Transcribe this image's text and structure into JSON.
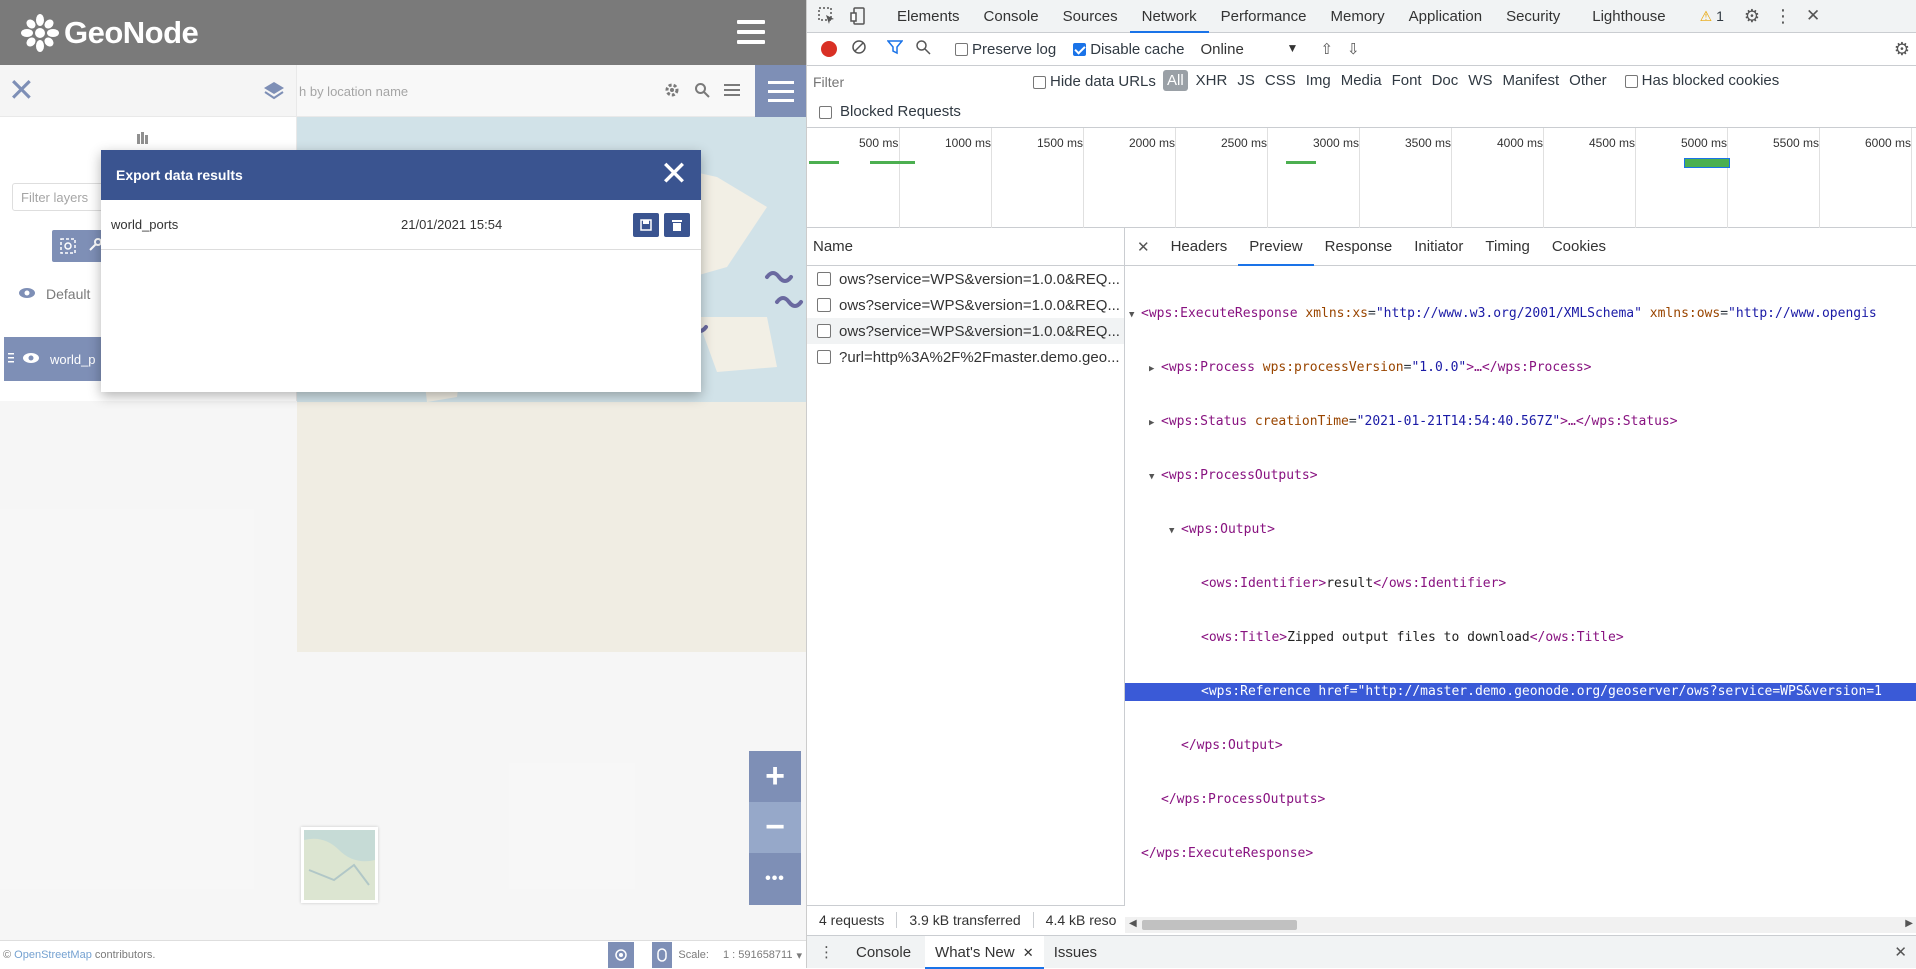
{
  "geonode": {
    "logo_text": "GeoNode",
    "search_placeholder": "h by location name",
    "filter_placeholder": "Filter layers",
    "group_name": "Default",
    "layer_name": "world_p",
    "attribution_prefix": "©",
    "attribution_link": "OpenStreetMap",
    "attribution_suffix": "contributors.",
    "scale_label": "Scale:",
    "scale_value": "1 : 591658711",
    "zoom_in": "+",
    "zoom_out": "−",
    "more": "•••"
  },
  "dialog": {
    "title": "Export data results",
    "row": {
      "name": "world_ports",
      "date": "21/01/2021 15:54"
    }
  },
  "devtools": {
    "tabs": [
      "Elements",
      "Console",
      "Sources",
      "Network",
      "Performance",
      "Memory",
      "Application",
      "Security",
      "Lighthouse"
    ],
    "active_tab": "Network",
    "warning_count": "1",
    "toolbar": {
      "preserve_log": "Preserve log",
      "disable_cache": "Disable cache",
      "throttle": "Online"
    },
    "filter": {
      "placeholder": "Filter",
      "hide_data_urls": "Hide data URLs",
      "types": [
        "All",
        "XHR",
        "JS",
        "CSS",
        "Img",
        "Media",
        "Font",
        "Doc",
        "WS",
        "Manifest",
        "Other"
      ],
      "has_blocked_cookies": "Has blocked cookies",
      "blocked_requests": "Blocked Requests"
    },
    "timeline_labels": [
      "500 ms",
      "1000 ms",
      "1500 ms",
      "2000 ms",
      "2500 ms",
      "3000 ms",
      "3500 ms",
      "4000 ms",
      "4500 ms",
      "5000 ms",
      "5500 ms",
      "6000 ms"
    ],
    "requests_header": "Name",
    "requests": [
      "ows?service=WPS&version=1.0.0&REQ...",
      "ows?service=WPS&version=1.0.0&REQ...",
      "ows?service=WPS&version=1.0.0&REQ...",
      "?url=http%3A%2F%2Fmaster.demo.geo..."
    ],
    "preview_tabs": [
      "Headers",
      "Preview",
      "Response",
      "Initiator",
      "Timing",
      "Cookies"
    ],
    "active_preview_tab": "Preview",
    "xml": {
      "l1_tag": "<wps:ExecuteResponse",
      "l1_attr1": "xmlns:xs",
      "l1_val1": "\"http://www.w3.org/2001/XMLSchema\"",
      "l1_attr2": "xmlns:ows",
      "l1_val2": "\"http://www.opengis",
      "l2_tag": "<wps:Process",
      "l2_attr": "wps:processVersion",
      "l2_val": "\"1.0.0\"",
      "l2_end": "</wps:Process>",
      "l3_tag": "<wps:Status",
      "l3_attr": "creationTime",
      "l3_val": "\"2021-01-21T14:54:40.567Z\"",
      "l3_end": "</wps:Status>",
      "l4": "<wps:ProcessOutputs>",
      "l5": "<wps:Output>",
      "l6_open": "<ows:Identifier>",
      "l6_text": "result",
      "l6_close": "</ows:Identifier>",
      "l7_open": "<ows:Title>",
      "l7_text": "Zipped output files to download",
      "l7_close": "</ows:Title>",
      "l8_tag": "<wps:Reference",
      "l8_attr": "href",
      "l8_val": "\"http://master.demo.geonode.org/geoserver/ows?service=WPS&version=1",
      "l9": "</wps:Output>",
      "l10": "</wps:ProcessOutputs>",
      "l11": "</wps:ExecuteResponse>"
    },
    "status": {
      "requests": "4 requests",
      "transferred": "3.9 kB transferred",
      "resources": "4.4 kB reso"
    },
    "drawer_tabs": [
      "Console",
      "What's New",
      "Issues"
    ],
    "active_drawer_tab": "What's New"
  },
  "colors": {
    "accent": "#3a5490",
    "devtools_blue": "#1a73e8",
    "selection": "#3a5ad7"
  }
}
